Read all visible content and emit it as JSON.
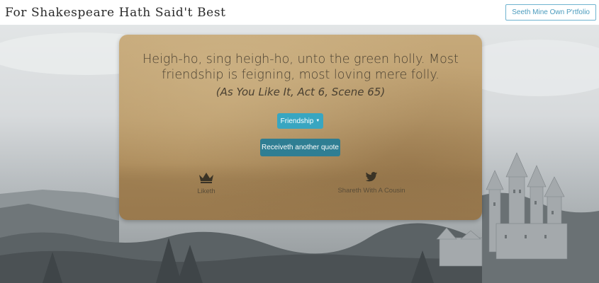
{
  "navbar": {
    "brand": "For Shakespeare Hath Said't Best",
    "portfolio_button": "Seeth Mine Own P'rtfolio"
  },
  "quote_card": {
    "quote_text": "Heigh-ho, sing heigh-ho, unto the green holly. Most friendship is feigning, most loving mere folly.",
    "source": "(As You Like It, Act 6, Scene 65)",
    "topic_dropdown": {
      "selected": "Friendship"
    },
    "another_button": "Receiveth another quote",
    "like": {
      "icon": "crown-icon",
      "label": "Liketh"
    },
    "share": {
      "icon": "twitter-icon",
      "label": "Shareth With A Cousin"
    }
  },
  "colors": {
    "topic_button": "#38a6c1",
    "another_button": "#2f7e93",
    "portfolio_accent": "#4a9bbd"
  }
}
